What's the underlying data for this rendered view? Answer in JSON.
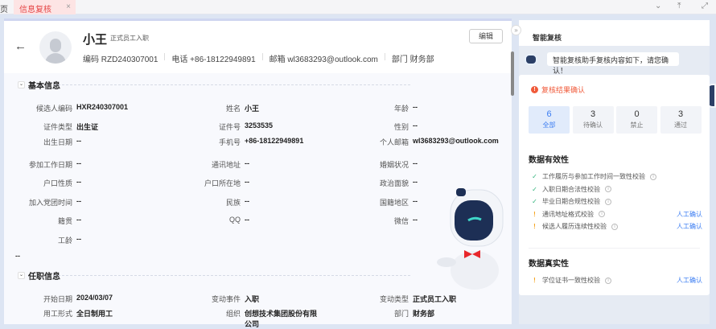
{
  "tabs": {
    "home": "页",
    "active": "信息复核"
  },
  "header": {
    "name": "小王",
    "type": "正式员工入职",
    "code": "编码 RZD240307001",
    "phone": "电话 +86-18122949891",
    "email": "邮箱 wl3683293@outlook.com",
    "dept": "部门 财务部",
    "edit_label": "编辑"
  },
  "basic": {
    "title": "基本信息",
    "fields": [
      {
        "label": "候选人编码",
        "value": "HXR240307001"
      },
      {
        "label": "姓名",
        "value": "小王"
      },
      {
        "label": "年龄",
        "value": "--"
      },
      {
        "label": "证件类型",
        "value": "出生证"
      },
      {
        "label": "证件号",
        "value": "3253535"
      },
      {
        "label": "性别",
        "value": "--"
      },
      {
        "label": "出生日期",
        "value": "--"
      },
      {
        "label": "手机号",
        "value": "+86-18122949891"
      },
      {
        "label": "个人邮箱",
        "value": "wl3683293@outlook.com"
      },
      {
        "label": "参加工作日期",
        "value": "--"
      },
      {
        "label": "通讯地址",
        "value": "--"
      },
      {
        "label": "婚姻状况",
        "value": "--"
      },
      {
        "label": "户口性质",
        "value": "--"
      },
      {
        "label": "户口所在地",
        "value": "--"
      },
      {
        "label": "政治面貌",
        "value": "--"
      },
      {
        "label": "加入党团时间",
        "value": "--"
      },
      {
        "label": "民族",
        "value": "--"
      },
      {
        "label": "国籍地区",
        "value": "--"
      },
      {
        "label": "籍贯",
        "value": "--"
      },
      {
        "label": "QQ",
        "value": "--"
      },
      {
        "label": "微信",
        "value": "--"
      },
      {
        "label": "工龄",
        "value": "--"
      }
    ],
    "trailing": "--"
  },
  "job": {
    "title": "任职信息",
    "fields": [
      {
        "label": "开始日期",
        "value": "2024/03/07"
      },
      {
        "label": "变动事件",
        "value": "入职"
      },
      {
        "label": "变动类型",
        "value": "正式员工入职"
      },
      {
        "label": "用工形式",
        "value": "全日制用工"
      },
      {
        "label": "组织",
        "value": "创想技术集团股份有限公司"
      },
      {
        "label": "部门",
        "value": "财务部"
      }
    ]
  },
  "review": {
    "title": "智能复核",
    "bubble": "智能复核助手复核内容如下，请您确认！",
    "alert": "复核结果确认",
    "stats": [
      {
        "n": "6",
        "t": "全部"
      },
      {
        "n": "3",
        "t": "待确认"
      },
      {
        "n": "0",
        "t": "禁止"
      },
      {
        "n": "3",
        "t": "通过"
      }
    ],
    "validity_title": "数据有效性",
    "validity": [
      {
        "s": "ok",
        "t": "工作履历与参加工作时间一致性校验"
      },
      {
        "s": "ok",
        "t": "入职日期合法性校验"
      },
      {
        "s": "ok",
        "t": "毕业日期合规性校验"
      },
      {
        "s": "warn",
        "t": "通讯地址格式校验",
        "a": "人工确认"
      },
      {
        "s": "warn",
        "t": "候选人履历连续性校验",
        "a": "人工确认"
      }
    ],
    "authenticity_title": "数据真实性",
    "authenticity": [
      {
        "s": "warn",
        "t": "学位证书一致性校验",
        "a": "人工确认"
      }
    ]
  },
  "colors": {
    "accent": "#3a7cf2",
    "warn": "#f5a623",
    "ok": "#2fb37a",
    "error": "#f05a3a"
  }
}
